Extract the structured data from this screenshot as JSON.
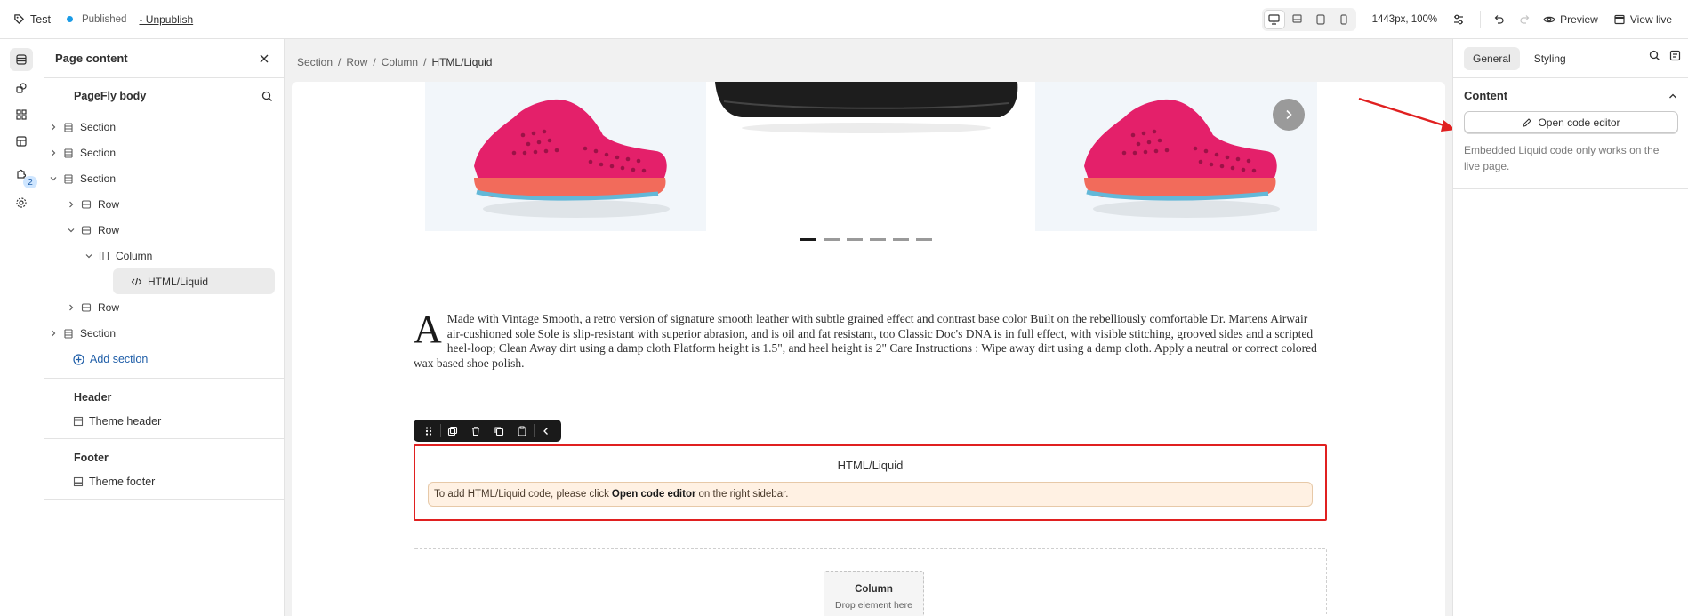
{
  "topbar": {
    "page_title": "Test",
    "status": "Published",
    "unpublish_label": "- Unpublish",
    "zoom": "1443px, 100%",
    "preview_label": "Preview",
    "view_live_label": "View live"
  },
  "rail": {
    "badge_count": "2"
  },
  "panel": {
    "title": "Page content",
    "body_title": "PageFly body",
    "tree": [
      {
        "label": "Section"
      },
      {
        "label": "Section"
      },
      {
        "label": "Section"
      },
      {
        "label": "Row"
      },
      {
        "label": "Row"
      },
      {
        "label": "Column"
      },
      {
        "label": "HTML/Liquid"
      },
      {
        "label": "Row"
      },
      {
        "label": "Section"
      }
    ],
    "add_section": "Add section",
    "header_title": "Header",
    "theme_header": "Theme header",
    "footer_title": "Footer",
    "theme_footer": "Theme footer"
  },
  "breadcrumb": {
    "items": [
      "Section",
      "Row",
      "Column",
      "HTML/Liquid"
    ]
  },
  "canvas": {
    "dropcap": "A",
    "paragraph": "Made with Vintage Smooth, a retro version of signature smooth leather with subtle grained effect and contrast base color Built on the rebelliously comfortable Dr. Martens Airwair air-cushioned sole Sole is slip-resistant with superior abrasion, and is oil and fat resistant, too Classic Doc's DNA is in full effect, with visible stitching, grooved sides and a scripted heel-loop; Clean Away dirt using a damp cloth Platform height is 1.5\", and heel height is 2\" Care Instructions : Wipe away dirt using a damp cloth. Apply a neutral or correct colored wax based shoe polish.",
    "slider_dots": 6,
    "slider_active_dot": 1,
    "html_title": "HTML/Liquid",
    "html_note_before": "To add HTML/Liquid code, please click",
    "html_note_bold": "Open code editor",
    "html_note_after": "on the right sidebar.",
    "column_title": "Column",
    "column_sub": "Drop element here"
  },
  "right_panel": {
    "tab_general": "General",
    "tab_styling": "Styling",
    "content_title": "Content",
    "code_button": "Open code editor",
    "hint": "Embedded Liquid code only works on the live page."
  },
  "colors": {
    "accent_red": "#e02020",
    "shoe_pink": "#e4206a",
    "sole_coral": "#f26b5b",
    "link_blue": "#1f5ea8"
  }
}
